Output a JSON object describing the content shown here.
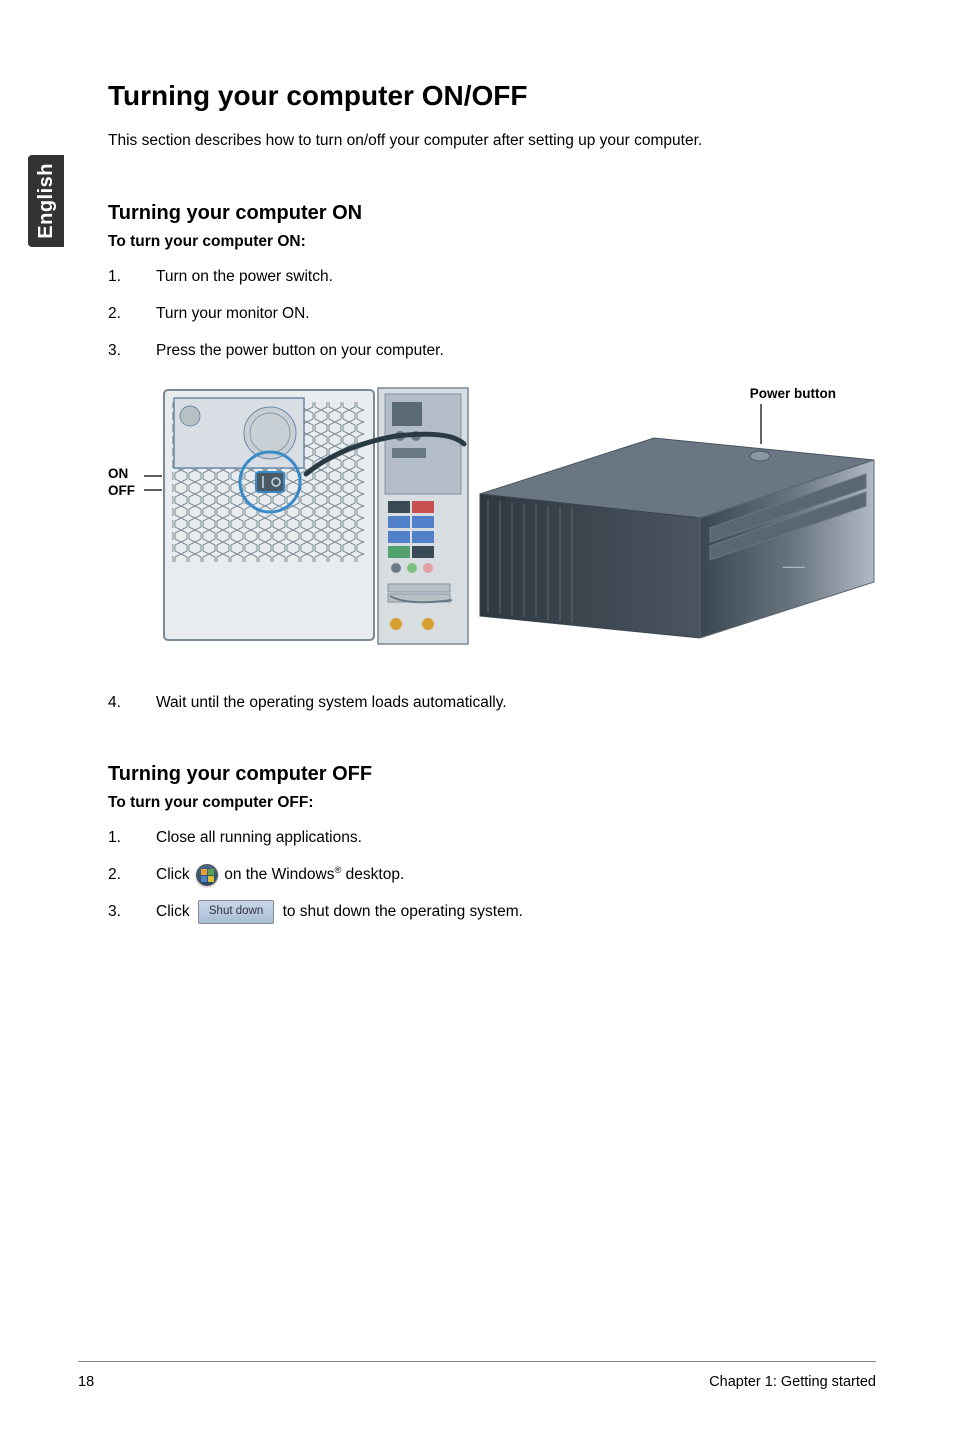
{
  "sidebar": {
    "language": "English"
  },
  "page": {
    "title": "Turning your computer ON/OFF",
    "intro": "This section describes how to turn on/off your computer after setting up your computer."
  },
  "on_section": {
    "heading": "Turning your computer ON",
    "lead": "To turn your computer ON:",
    "steps": {
      "s1_num": "1.",
      "s1_text": "Turn on the power switch.",
      "s2_num": "2.",
      "s2_text": "Turn your monitor ON.",
      "s3_num": "3.",
      "s3_text": "Press the power button on your computer.",
      "s4_num": "4.",
      "s4_text": "Wait until the operating system loads automatically."
    }
  },
  "figure": {
    "on_label": "ON",
    "off_label": "OFF",
    "power_button_label": "Power button"
  },
  "off_section": {
    "heading": "Turning your computer OFF",
    "lead": "To turn your computer OFF:",
    "steps": {
      "s1_num": "1.",
      "s1_text": "Close all running applications.",
      "s2_num": "2.",
      "s2_pre": "Click ",
      "s2_post_a": " on the Windows",
      "s2_sup": "®",
      "s2_post_b": " desktop.",
      "s3_num": "3.",
      "s3_pre": "Click ",
      "s3_btn": "Shut down",
      "s3_post": " to shut down the operating system."
    }
  },
  "footer": {
    "page_num": "18",
    "chapter": "Chapter 1: Getting started"
  }
}
